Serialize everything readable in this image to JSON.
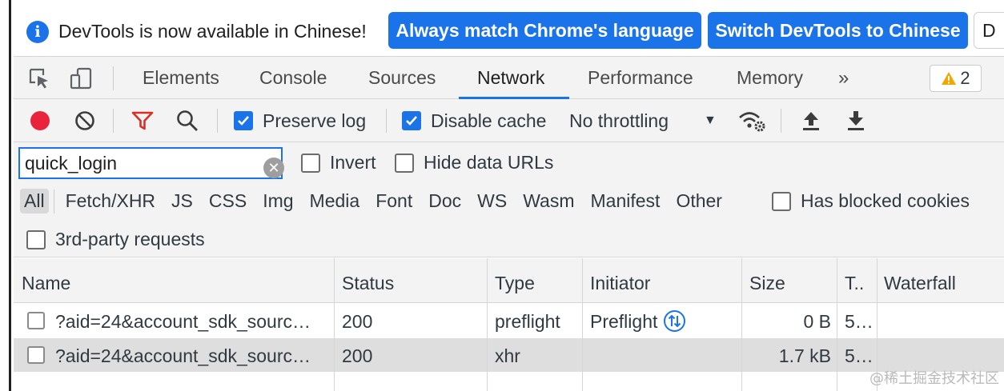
{
  "infobar": {
    "icon": "info-icon",
    "message": "DevTools is now available in Chinese!",
    "btn_always_match": "Always match Chrome's language",
    "btn_switch": "Switch DevTools to Chinese",
    "btn_dont_show": "D"
  },
  "tabs": {
    "items": [
      "Elements",
      "Console",
      "Sources",
      "Network",
      "Performance",
      "Memory"
    ],
    "active": "Network",
    "more": "»",
    "warning_count": "2"
  },
  "network_toolbar": {
    "preserve_log": {
      "label": "Preserve log",
      "checked": true
    },
    "disable_cache": {
      "label": "Disable cache",
      "checked": true
    },
    "throttling": "No throttling"
  },
  "filter": {
    "value": "quick_login",
    "invert_label": "Invert",
    "hide_data_urls_label": "Hide data URLs",
    "types": [
      "All",
      "Fetch/XHR",
      "JS",
      "CSS",
      "Img",
      "Media",
      "Font",
      "Doc",
      "WS",
      "Wasm",
      "Manifest",
      "Other"
    ],
    "active_type": "All",
    "blocked_cookies_label": "Has blocked cookies",
    "third_party_label": "3rd-party requests"
  },
  "table": {
    "columns": [
      "Name",
      "Status",
      "Type",
      "Initiator",
      "Size",
      "T..",
      "Waterfall"
    ],
    "rows": [
      {
        "name": "?aid=24&account_sdk_sourc…",
        "status": "200",
        "type": "preflight",
        "initiator": "Preflight",
        "size": "0 B",
        "time": "5…"
      },
      {
        "name": "?aid=24&account_sdk_sourc…",
        "status": "200",
        "type": "xhr",
        "initiator": "",
        "size": "1.7 kB",
        "time": "5…"
      }
    ]
  },
  "watermark": "@稀土掘金技术社区",
  "colors": {
    "accent": "#1a73e8",
    "record": "#e8233b",
    "filter_active": "#d93025",
    "warning": "#f2a600"
  }
}
